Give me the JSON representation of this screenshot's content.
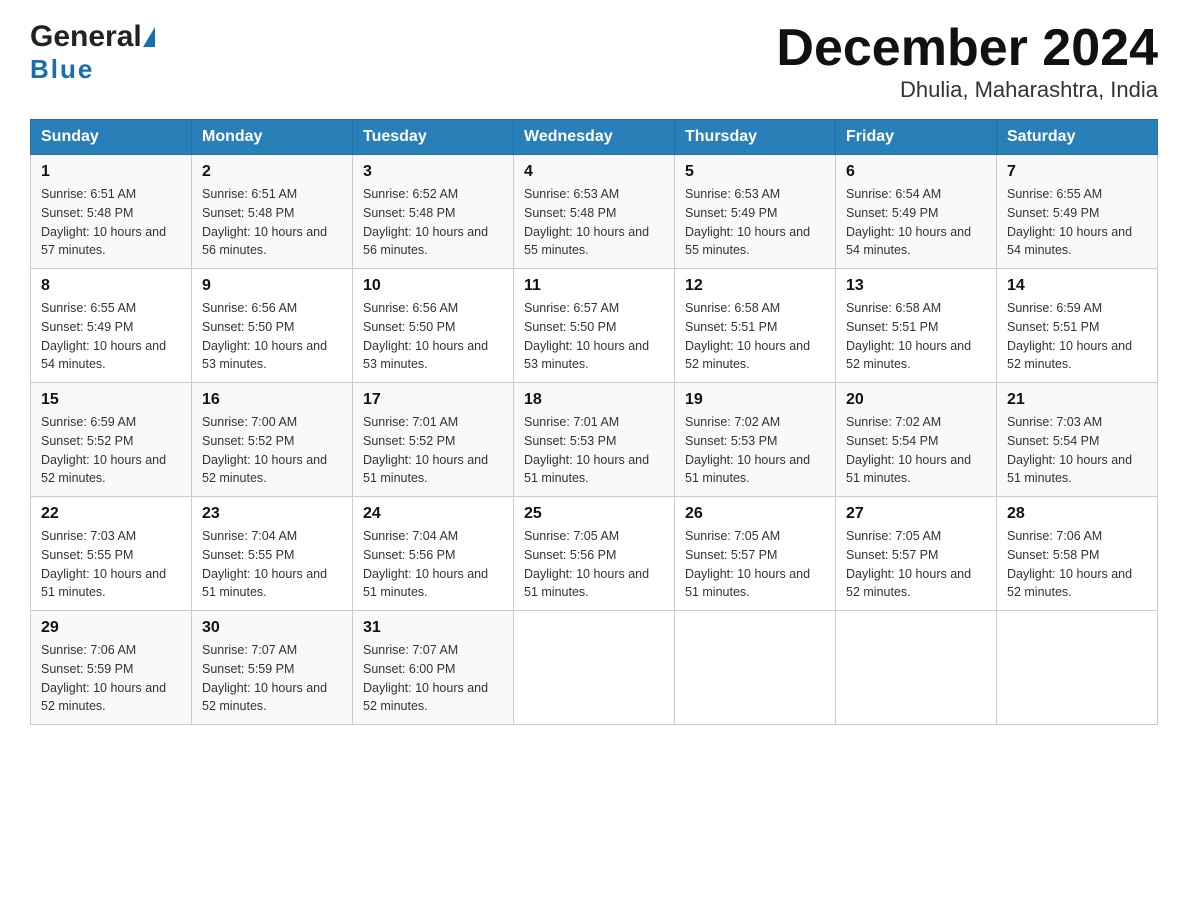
{
  "header": {
    "title": "December 2024",
    "subtitle": "Dhulia, Maharashtra, India",
    "logo_general": "General",
    "logo_blue": "Blue"
  },
  "days_of_week": [
    "Sunday",
    "Monday",
    "Tuesday",
    "Wednesday",
    "Thursday",
    "Friday",
    "Saturday"
  ],
  "weeks": [
    [
      {
        "day": "1",
        "sunrise": "6:51 AM",
        "sunset": "5:48 PM",
        "daylight": "10 hours and 57 minutes."
      },
      {
        "day": "2",
        "sunrise": "6:51 AM",
        "sunset": "5:48 PM",
        "daylight": "10 hours and 56 minutes."
      },
      {
        "day": "3",
        "sunrise": "6:52 AM",
        "sunset": "5:48 PM",
        "daylight": "10 hours and 56 minutes."
      },
      {
        "day": "4",
        "sunrise": "6:53 AM",
        "sunset": "5:48 PM",
        "daylight": "10 hours and 55 minutes."
      },
      {
        "day": "5",
        "sunrise": "6:53 AM",
        "sunset": "5:49 PM",
        "daylight": "10 hours and 55 minutes."
      },
      {
        "day": "6",
        "sunrise": "6:54 AM",
        "sunset": "5:49 PM",
        "daylight": "10 hours and 54 minutes."
      },
      {
        "day": "7",
        "sunrise": "6:55 AM",
        "sunset": "5:49 PM",
        "daylight": "10 hours and 54 minutes."
      }
    ],
    [
      {
        "day": "8",
        "sunrise": "6:55 AM",
        "sunset": "5:49 PM",
        "daylight": "10 hours and 54 minutes."
      },
      {
        "day": "9",
        "sunrise": "6:56 AM",
        "sunset": "5:50 PM",
        "daylight": "10 hours and 53 minutes."
      },
      {
        "day": "10",
        "sunrise": "6:56 AM",
        "sunset": "5:50 PM",
        "daylight": "10 hours and 53 minutes."
      },
      {
        "day": "11",
        "sunrise": "6:57 AM",
        "sunset": "5:50 PM",
        "daylight": "10 hours and 53 minutes."
      },
      {
        "day": "12",
        "sunrise": "6:58 AM",
        "sunset": "5:51 PM",
        "daylight": "10 hours and 52 minutes."
      },
      {
        "day": "13",
        "sunrise": "6:58 AM",
        "sunset": "5:51 PM",
        "daylight": "10 hours and 52 minutes."
      },
      {
        "day": "14",
        "sunrise": "6:59 AM",
        "sunset": "5:51 PM",
        "daylight": "10 hours and 52 minutes."
      }
    ],
    [
      {
        "day": "15",
        "sunrise": "6:59 AM",
        "sunset": "5:52 PM",
        "daylight": "10 hours and 52 minutes."
      },
      {
        "day": "16",
        "sunrise": "7:00 AM",
        "sunset": "5:52 PM",
        "daylight": "10 hours and 52 minutes."
      },
      {
        "day": "17",
        "sunrise": "7:01 AM",
        "sunset": "5:52 PM",
        "daylight": "10 hours and 51 minutes."
      },
      {
        "day": "18",
        "sunrise": "7:01 AM",
        "sunset": "5:53 PM",
        "daylight": "10 hours and 51 minutes."
      },
      {
        "day": "19",
        "sunrise": "7:02 AM",
        "sunset": "5:53 PM",
        "daylight": "10 hours and 51 minutes."
      },
      {
        "day": "20",
        "sunrise": "7:02 AM",
        "sunset": "5:54 PM",
        "daylight": "10 hours and 51 minutes."
      },
      {
        "day": "21",
        "sunrise": "7:03 AM",
        "sunset": "5:54 PM",
        "daylight": "10 hours and 51 minutes."
      }
    ],
    [
      {
        "day": "22",
        "sunrise": "7:03 AM",
        "sunset": "5:55 PM",
        "daylight": "10 hours and 51 minutes."
      },
      {
        "day": "23",
        "sunrise": "7:04 AM",
        "sunset": "5:55 PM",
        "daylight": "10 hours and 51 minutes."
      },
      {
        "day": "24",
        "sunrise": "7:04 AM",
        "sunset": "5:56 PM",
        "daylight": "10 hours and 51 minutes."
      },
      {
        "day": "25",
        "sunrise": "7:05 AM",
        "sunset": "5:56 PM",
        "daylight": "10 hours and 51 minutes."
      },
      {
        "day": "26",
        "sunrise": "7:05 AM",
        "sunset": "5:57 PM",
        "daylight": "10 hours and 51 minutes."
      },
      {
        "day": "27",
        "sunrise": "7:05 AM",
        "sunset": "5:57 PM",
        "daylight": "10 hours and 52 minutes."
      },
      {
        "day": "28",
        "sunrise": "7:06 AM",
        "sunset": "5:58 PM",
        "daylight": "10 hours and 52 minutes."
      }
    ],
    [
      {
        "day": "29",
        "sunrise": "7:06 AM",
        "sunset": "5:59 PM",
        "daylight": "10 hours and 52 minutes."
      },
      {
        "day": "30",
        "sunrise": "7:07 AM",
        "sunset": "5:59 PM",
        "daylight": "10 hours and 52 minutes."
      },
      {
        "day": "31",
        "sunrise": "7:07 AM",
        "sunset": "6:00 PM",
        "daylight": "10 hours and 52 minutes."
      },
      null,
      null,
      null,
      null
    ]
  ],
  "label_sunrise": "Sunrise:",
  "label_sunset": "Sunset:",
  "label_daylight": "Daylight:"
}
